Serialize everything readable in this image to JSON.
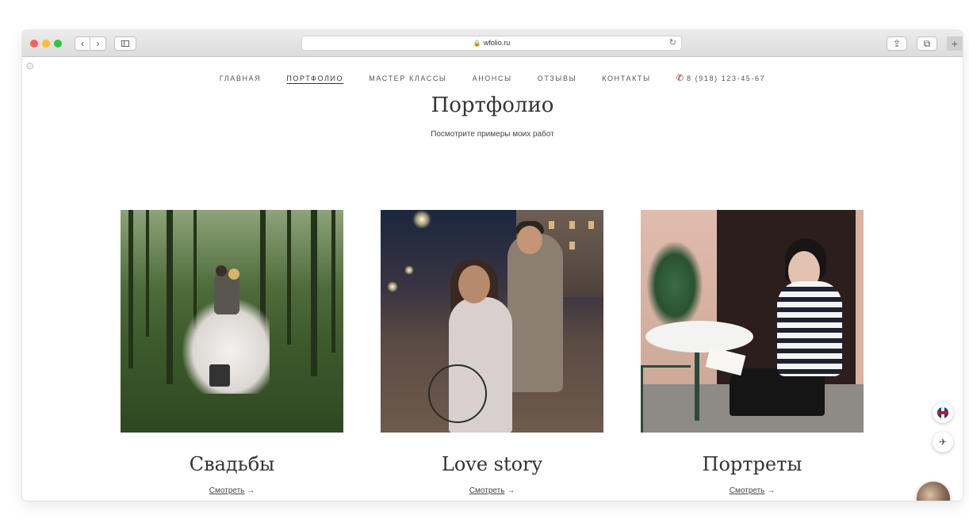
{
  "browser": {
    "url": "wfolio.ru",
    "back_glyph": "‹",
    "forward_glyph": "›",
    "reload_glyph": "↻",
    "lock_glyph": "🔒",
    "share_glyph": "⇪",
    "tabs_glyph": "⧉",
    "newtab_glyph": "+"
  },
  "nav": {
    "items": [
      "Главная",
      "Портфолио",
      "Мастер классы",
      "Анонсы",
      "Отзывы",
      "Контакты"
    ],
    "active_index": 1,
    "phone": "8 (918) 123-45-67",
    "phone_icon_color": "#8b1a1a"
  },
  "page": {
    "title": "Портфолио",
    "subtitle": "Посмотрите примеры моих работ"
  },
  "cards": [
    {
      "title": "Свадьбы",
      "link": "Смотреть",
      "arrow": "→"
    },
    {
      "title": "Love story",
      "link": "Смотреть",
      "arrow": "→"
    },
    {
      "title": "Портреты",
      "link": "Смотреть",
      "arrow": "→"
    }
  ],
  "widgets": {
    "send_glyph": "✈"
  }
}
